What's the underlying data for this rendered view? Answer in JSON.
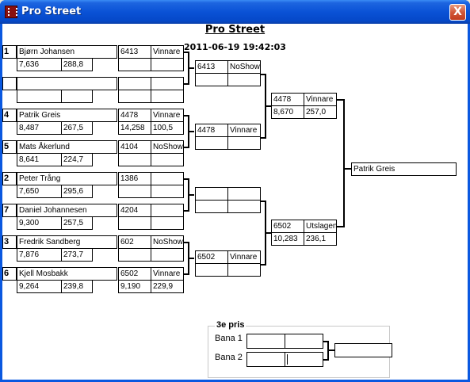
{
  "window": {
    "title": "Pro Street",
    "close_label": "X"
  },
  "header": {
    "title": "Pro Street",
    "datetime": "2011-06-19 19:42:03"
  },
  "round1": [
    {
      "seed": "1",
      "name": "Bjørn Johansen",
      "rt": "7,636",
      "speed": "288,8",
      "id": "6413",
      "result": "Vinnare",
      "et": "",
      "mph": ""
    },
    {
      "seed": "",
      "name": "",
      "rt": "",
      "speed": "",
      "id": "",
      "result": "",
      "et": "",
      "mph": ""
    },
    {
      "seed": "4",
      "name": "Patrik Greis",
      "rt": "8,487",
      "speed": "267,5",
      "id": "4478",
      "result": "Vinnare",
      "et": "14,258",
      "mph": "100,5"
    },
    {
      "seed": "5",
      "name": "Mats Åkerlund",
      "rt": "8,641",
      "speed": "224,7",
      "id": "4104",
      "result": "NoShow",
      "et": "",
      "mph": ""
    },
    {
      "seed": "2",
      "name": "Peter Trång",
      "rt": "7,650",
      "speed": "295,6",
      "id": "1386",
      "result": "",
      "et": "",
      "mph": ""
    },
    {
      "seed": "7",
      "name": "Daniel Johannesen",
      "rt": "9,300",
      "speed": "257,5",
      "id": "4204",
      "result": "",
      "et": "",
      "mph": ""
    },
    {
      "seed": "3",
      "name": "Fredrik Sandberg",
      "rt": "7,876",
      "speed": "273,7",
      "id": "602",
      "result": "NoShow",
      "et": "",
      "mph": ""
    },
    {
      "seed": "6",
      "name": "Kjell Mosbakk",
      "rt": "9,264",
      "speed": "239,8",
      "id": "6502",
      "result": "Vinnare",
      "et": "9,190",
      "mph": "229,9"
    }
  ],
  "round2": [
    {
      "id": "6413",
      "result": "NoShow",
      "et": "",
      "mph": ""
    },
    {
      "id": "4478",
      "result": "Vinnare",
      "et": "",
      "mph": ""
    },
    {
      "id": "",
      "result": "",
      "et": "",
      "mph": ""
    },
    {
      "id": "6502",
      "result": "Vinnare",
      "et": "",
      "mph": ""
    }
  ],
  "round3": [
    {
      "id": "4478",
      "result": "Vinnare",
      "et": "8,670",
      "mph": "257,0"
    },
    {
      "id": "6502",
      "result": "Utslagen",
      "et": "10,283",
      "mph": "236,1"
    }
  ],
  "winner": {
    "name": "Patrik Greis"
  },
  "third_prize": {
    "title": "3e pris",
    "lane1_label": "Bana 1",
    "lane2_label": "Bana 2"
  }
}
